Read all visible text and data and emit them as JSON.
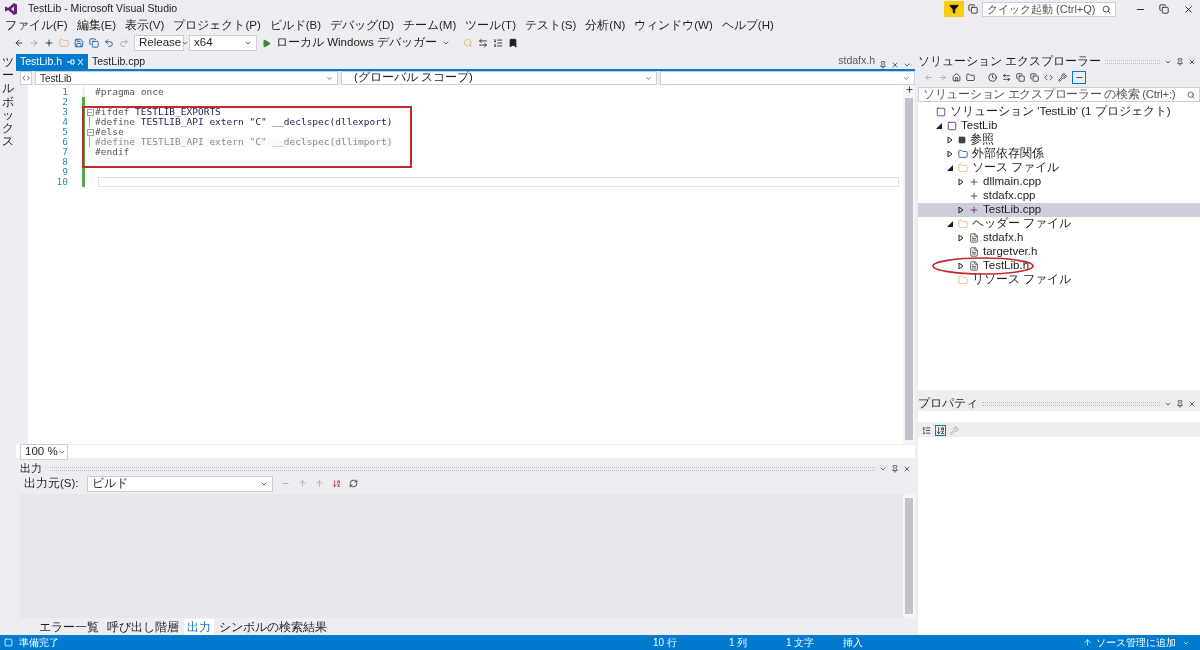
{
  "window": {
    "title": "TestLib - Microsoft Visual Studio",
    "quick_launch": {
      "placeholder": "クイック起動 (Ctrl+Q)"
    }
  },
  "menu": [
    "ファイル(F)",
    "編集(E)",
    "表示(V)",
    "プロジェクト(P)",
    "ビルド(B)",
    "デバッグ(D)",
    "チーム(M)",
    "ツール(T)",
    "テスト(S)",
    "分析(N)",
    "ウィンドウ(W)",
    "ヘルプ(H)"
  ],
  "toolbar": {
    "configuration": "Release",
    "platform": "x64",
    "debugger": "ローカル Windows デバッガー"
  },
  "sidebar_label": "ツールボックス",
  "document_tabs": [
    {
      "label": "TestLib.h",
      "selected": true
    },
    {
      "label": "TestLib.cpp",
      "selected": false
    }
  ],
  "preview_tab": "stdafx.h",
  "nav_bar": {
    "project": "TestLib",
    "scope": "(グローバル スコープ)"
  },
  "code_lines": [
    {
      "number": "1",
      "changed": false,
      "inactive": false,
      "kind": "plain",
      "segments": [
        {
          "kind": "directive",
          "text": "#pragma once"
        }
      ]
    },
    {
      "number": "2",
      "changed": true,
      "inactive": false,
      "kind": "plain"
    },
    {
      "number": "3",
      "changed": true,
      "inactive": false,
      "kind": "opener",
      "segments": [
        {
          "kind": "directive",
          "text": "#ifdef"
        },
        {
          "kind": "code",
          "text": "TESTLIB_EXPORTS"
        }
      ]
    },
    {
      "number": "4",
      "changed": true,
      "inactive": false,
      "kind": "nested",
      "segments": [
        {
          "kind": "directive",
          "text": "#define"
        },
        {
          "kind": "code",
          "text": "TESTLIB_API extern \"C\" __declspec(dllexport)"
        }
      ]
    },
    {
      "number": "5",
      "changed": true,
      "inactive": false,
      "kind": "opener",
      "segments": [
        {
          "kind": "directive",
          "text": "#else"
        }
      ]
    },
    {
      "number": "6",
      "changed": true,
      "inactive": true,
      "kind": "nested",
      "segments": [
        {
          "kind": "directive",
          "text": "#define"
        },
        {
          "kind": "code",
          "text": "TESTLIB_API extern \"C\" __declspec(dllimport)"
        }
      ]
    },
    {
      "number": "7",
      "changed": true,
      "inactive": false,
      "kind": "plain",
      "segments": [
        {
          "kind": "directive",
          "text": "#endif"
        }
      ]
    },
    {
      "number": "8",
      "changed": true,
      "inactive": false,
      "kind": "plain"
    },
    {
      "number": "9",
      "changed": true,
      "inactive": false,
      "kind": "plain"
    },
    {
      "number": "10",
      "changed": true,
      "inactive": false,
      "kind": "plain"
    }
  ],
  "zoom": "100 %",
  "output": {
    "title": "出力",
    "source_label": "出力元(S):",
    "source": "ビルド"
  },
  "bottom_tabs": [
    {
      "label": "エラー一覧",
      "selected": false
    },
    {
      "label": "呼び出し階層",
      "selected": false
    },
    {
      "label": "出力",
      "selected": true
    },
    {
      "label": "シンボルの検索結果",
      "selected": false
    }
  ],
  "solution_explorer": {
    "title": "ソリューション エクスプローラー",
    "search": {
      "placeholder": "ソリューション エクスプローラー の検索 (Ctrl+:)"
    },
    "tree": [
      {
        "label": "ソリューション 'TestLib' (1 プロジェクト)",
        "kind": "solution",
        "selected": false,
        "children": [
          {
            "label": "TestLib",
            "kind": "project",
            "expanded": true,
            "selected": false,
            "children": [
              {
                "label": "参照",
                "kind": "references",
                "expanded": false,
                "selected": false
              },
              {
                "label": "外部依存関係",
                "kind": "external",
                "expanded": false,
                "selected": false
              },
              {
                "label": "ソース ファイル",
                "kind": "folder",
                "expanded": true,
                "selected": false,
                "children": [
                  {
                    "label": "dllmain.cpp",
                    "kind": "cpp",
                    "expanded": false,
                    "selected": false
                  },
                  {
                    "label": "stdafx.cpp",
                    "kind": "cpp",
                    "selected": false
                  },
                  {
                    "label": "TestLib.cpp",
                    "kind": "cpp",
                    "expanded": false,
                    "selected": true
                  }
                ]
              },
              {
                "label": "ヘッダー ファイル",
                "kind": "folder",
                "expanded": true,
                "selected": false,
                "children": [
                  {
                    "label": "stdafx.h",
                    "kind": "header",
                    "expanded": false,
                    "selected": false
                  },
                  {
                    "label": "targetver.h",
                    "kind": "header",
                    "selected": false
                  },
                  {
                    "label": "TestLib.h",
                    "kind": "header",
                    "expanded": false,
                    "selected": false
                  }
                ]
              },
              {
                "label": "リソース ファイル",
                "kind": "folder",
                "selected": false
              }
            ]
          }
        ]
      }
    ]
  },
  "properties": {
    "title": "プロパティ"
  },
  "status_bar": {
    "message": "準備完了",
    "line": "10 行",
    "column": "1 列",
    "char": "1 文字",
    "mode": "挿入",
    "source_control": "ソース管理に追加"
  }
}
